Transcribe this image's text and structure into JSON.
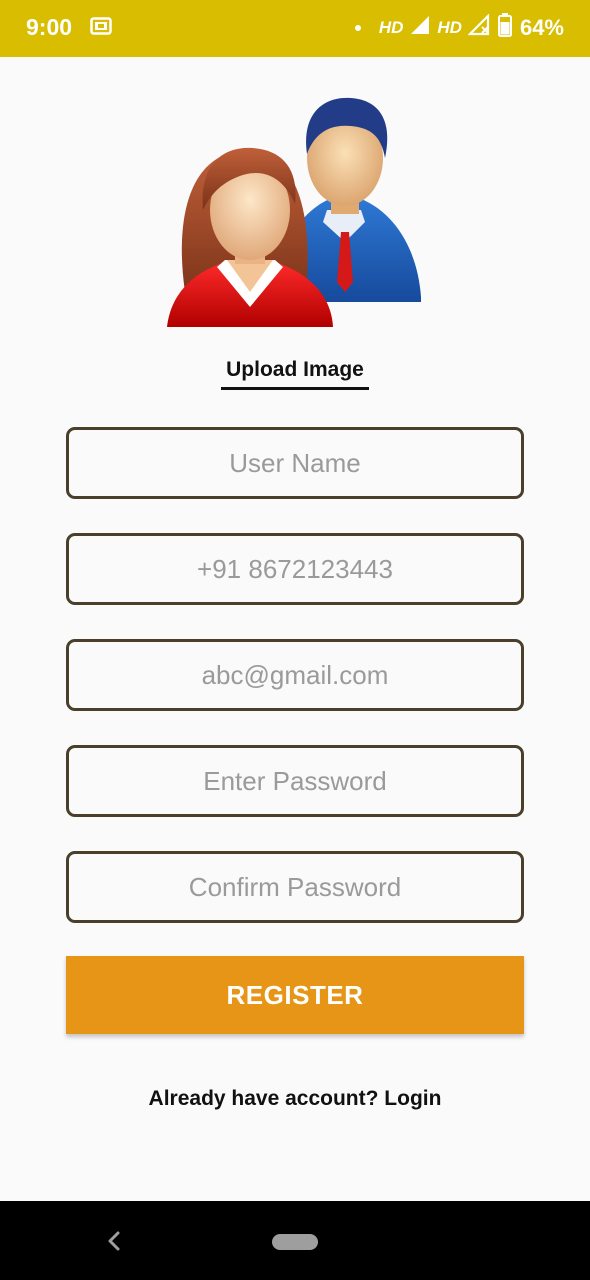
{
  "status_bar": {
    "time": "9:00",
    "hd1": "HD",
    "hd2": "HD",
    "battery": "64%",
    "icons": [
      "screenshot-icon",
      "dot-icon",
      "signal-icon",
      "signal-off-icon",
      "battery-icon"
    ]
  },
  "avatar": {
    "icon": "users-avatar-icon"
  },
  "upload_label": "Upload Image",
  "fields": {
    "username": {
      "placeholder": "User Name"
    },
    "phone": {
      "placeholder": "+91 8672123443"
    },
    "email": {
      "placeholder": "abc@gmail.com"
    },
    "password": {
      "placeholder": "Enter Password"
    },
    "confirm": {
      "placeholder": "Confirm Password"
    }
  },
  "register_label": "REGISTER",
  "login_text": "Already have account? Login",
  "colors": {
    "status_bar": "#d9bd00",
    "button": "#e69516",
    "field_border": "#4a3f2a",
    "background": "#fafafa"
  },
  "nav": {
    "icons": [
      "back-icon",
      "home-pill-icon"
    ]
  }
}
